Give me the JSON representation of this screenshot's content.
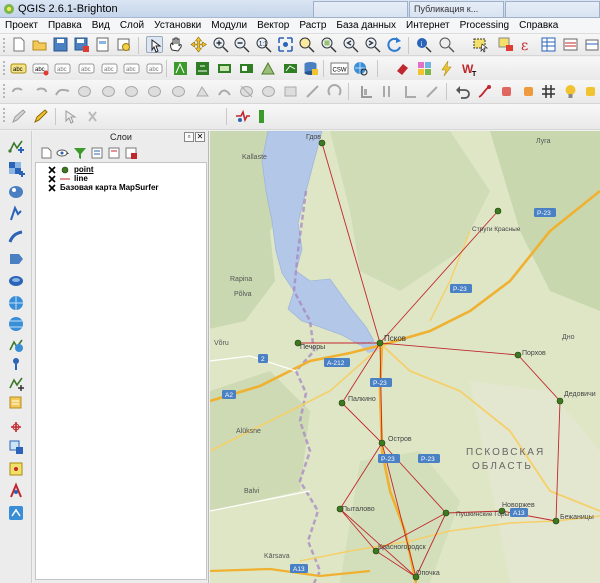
{
  "window": {
    "title": "QGIS 2.6.1-Brighton",
    "tabs": [
      "",
      "Публикация к...",
      ""
    ]
  },
  "menu": [
    "Проект",
    "Правка",
    "Вид",
    "Слой",
    "Установки",
    "Модули",
    "Вектор",
    "Растр",
    "База данных",
    "Интернет",
    "Processing",
    "Справка"
  ],
  "toolbar": {
    "csw_label": "CSW",
    "row1": [
      "new-project-icon",
      "open-project-icon",
      "save-project-icon",
      "save-as-icon",
      "print-composer-icon",
      "composer-manager-icon",
      "select-cursor-icon",
      "pan-icon",
      "pan-to-selection-icon",
      "zoom-in-icon",
      "zoom-out-icon",
      "zoom-native-icon",
      "zoom-full-icon",
      "zoom-to-selection-icon",
      "zoom-to-layer-icon",
      "zoom-last-icon",
      "zoom-next-icon",
      "refresh-icon",
      "identify-icon",
      "measure-icon",
      "select-features-icon",
      "deselect-icon",
      "field-calculator-icon",
      "attribute-table-icon",
      "statistics-icon"
    ],
    "row2": [
      "label-icon",
      "label-pin-icon",
      "label-show-icon",
      "label-move-icon",
      "label-rotate-icon",
      "label-change-icon",
      "grass-icon",
      "grass-tools-icon",
      "grass-raster-icon",
      "grass-region-icon",
      "grass-edit-icon",
      "db-manager-icon",
      "csw-icon",
      "metasearch-icon",
      "rubber-icon",
      "fractal-icon",
      "zap-icon",
      "wfst-icon"
    ],
    "row3": [
      "advanced-digitize-icon"
    ],
    "row4": [
      "toggle-edit-icon",
      "edit-pencil-icon",
      "plugin-icon",
      "route-icon"
    ]
  },
  "left_toolbar": [
    "add-vector-icon",
    "add-raster-icon",
    "add-postgis-icon",
    "add-spatialite-icon",
    "add-mssql-icon",
    "add-oracle-icon",
    "add-sqlanywhere-icon",
    "add-wms-icon",
    "add-wcs-icon",
    "add-wfs-icon",
    "add-delimited-icon",
    "new-shapefile-icon",
    "new-spatialite-icon",
    "gps-icon",
    "coordinate-capture-icon",
    "georeferencer-icon",
    "heatmap-icon",
    "openlayers-icon"
  ],
  "layers_panel": {
    "title": "Слои",
    "buttons": [
      "add-group-icon",
      "manage-visibility-icon",
      "filter-legend-icon",
      "expand-all-icon",
      "collapse-all-icon",
      "remove-layer-icon"
    ],
    "layers": [
      {
        "name": "point",
        "checked": true,
        "symbol": "point"
      },
      {
        "name": "line",
        "checked": true,
        "symbol": "line"
      },
      {
        "name": "Базовая карта MapSurfer",
        "checked": true,
        "symbol": "none"
      }
    ]
  },
  "map": {
    "labels": [
      "Гдов",
      "Kallaste",
      "Луга",
      "Струги Красные",
      "Rapina",
      "Põlva",
      "Võru",
      "Печоры",
      "Псков",
      "Порхов",
      "Дно",
      "Дедовичи",
      "Палкино",
      "Остров",
      "ПСКОВСКАЯ",
      "ОБЛАСТЬ",
      "Alūksne",
      "Balvi",
      "Пушкинские Горы",
      "Новоржев",
      "Бежаницы",
      "Пыталово",
      "Красногородск",
      "Опочка",
      "Kārsava"
    ],
    "road_labels": [
      "P-23",
      "P-23",
      "A-212",
      "P-23",
      "P-23",
      "P-23",
      "2",
      "A2",
      "A13",
      "A13"
    ],
    "colors": {
      "accent": "#f0b030",
      "line": "#c0282e",
      "point": "#3d7a1f",
      "water": "#b3c8e8"
    }
  }
}
